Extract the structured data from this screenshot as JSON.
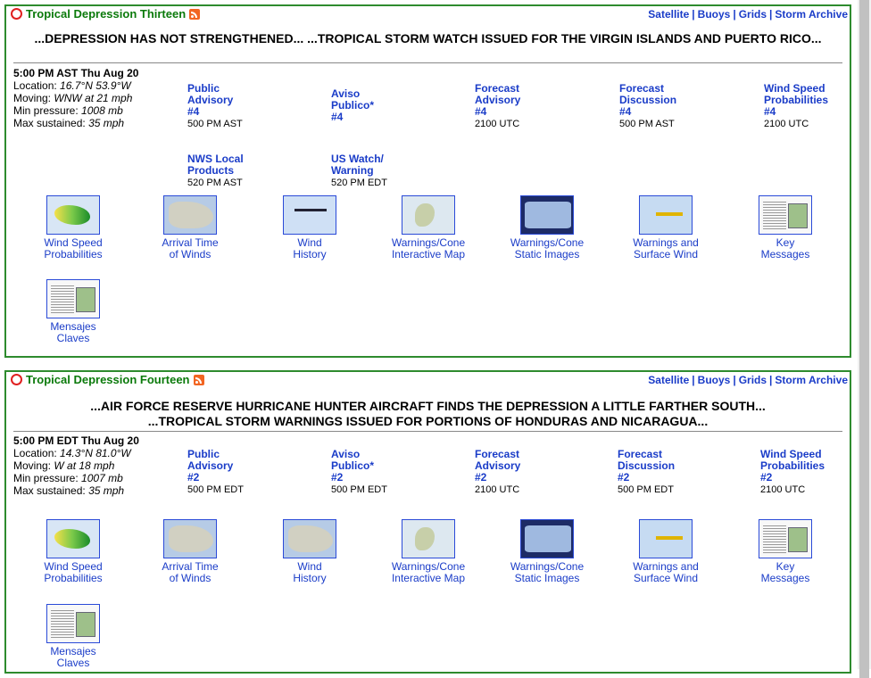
{
  "storms": [
    {
      "title": "Tropical Depression Thirteen",
      "links": [
        "Satellite",
        "Buoys",
        "Grids",
        "Storm Archive"
      ],
      "headline": "...DEPRESSION HAS NOT STRENGTHENED... ...TROPICAL STORM WATCH ISSUED FOR THE VIRGIN ISLANDS AND PUERTO RICO...",
      "datetime": "5:00 PM AST Thu Aug 20",
      "location_label": "Location:",
      "location": "16.7°N 53.9°W",
      "moving_label": "Moving:",
      "moving": "WNW at 21 mph",
      "pressure_label": "Min pressure:",
      "pressure": "1008 mb",
      "sustained_label": "Max sustained:",
      "sustained": "35 mph",
      "products": [
        {
          "line1": "Public",
          "line2": "Advisory",
          "num": "#4",
          "time": "500 PM AST"
        },
        {
          "line1": "Aviso",
          "line2": "Publico*",
          "num": "#4",
          "time": ""
        },
        {
          "line1": "Forecast",
          "line2": "Advisory",
          "num": "#4",
          "time": "2100 UTC"
        },
        {
          "line1": "Forecast",
          "line2": "Discussion",
          "num": "#4",
          "time": "500 PM AST"
        },
        {
          "line1": "Wind Speed",
          "line2": "Probabilities",
          "num": "#4",
          "time": "2100 UTC"
        },
        {
          "line1": "NWS Local",
          "line2": "Products",
          "num": "",
          "time": "520 PM AST"
        },
        {
          "line1": "US Watch/",
          "line2": "Warning",
          "num": "",
          "time": "520 PM EDT"
        }
      ],
      "graphics": [
        {
          "l1": "Wind Speed",
          "l2": "Probabilities",
          "icon": "wind-probability-map-icon"
        },
        {
          "l1": "Arrival Time",
          "l2": "of Winds",
          "icon": "arrival-time-map-icon"
        },
        {
          "l1": "Wind",
          "l2": "History",
          "icon": "wind-history-map-icon"
        },
        {
          "l1": "Warnings/Cone",
          "l2": "Interactive Map",
          "icon": "interactive-map-icon"
        },
        {
          "l1": "Warnings/Cone",
          "l2": "Static Images",
          "icon": "cone-map-icon"
        },
        {
          "l1": "Warnings and",
          "l2": "Surface Wind",
          "icon": "surface-wind-map-icon"
        },
        {
          "l1": "Key",
          "l2": "Messages",
          "icon": "key-messages-doc-icon"
        },
        {
          "l1": "Mensajes",
          "l2": "Claves",
          "icon": "mensajes-claves-doc-icon"
        }
      ]
    },
    {
      "title": "Tropical Depression Fourteen",
      "links": [
        "Satellite",
        "Buoys",
        "Grids",
        "Storm Archive"
      ],
      "headline1": "...AIR FORCE RESERVE HURRICANE HUNTER AIRCRAFT FINDS THE DEPRESSION A LITTLE FARTHER SOUTH...",
      "headline2": "...TROPICAL STORM WARNINGS ISSUED FOR PORTIONS OF HONDURAS AND NICARAGUA...",
      "datetime": "5:00 PM EDT Thu Aug 20",
      "location_label": "Location:",
      "location": "14.3°N 81.0°W",
      "moving_label": "Moving:",
      "moving": "W at 18 mph",
      "pressure_label": "Min pressure:",
      "pressure": "1007 mb",
      "sustained_label": "Max sustained:",
      "sustained": "35 mph",
      "products": [
        {
          "line1": "Public",
          "line2": "Advisory",
          "num": "#2",
          "time": "500 PM EDT"
        },
        {
          "line1": "Aviso",
          "line2": "Publico*",
          "num": "#2",
          "time": "500 PM EDT"
        },
        {
          "line1": "Forecast",
          "line2": "Advisory",
          "num": "#2",
          "time": "2100 UTC"
        },
        {
          "line1": "Forecast",
          "line2": "Discussion",
          "num": "#2",
          "time": "500 PM EDT"
        },
        {
          "line1": "Wind Speed",
          "line2": "Probabilities",
          "num": "#2",
          "time": "2100 UTC"
        }
      ],
      "graphics": [
        {
          "l1": "Wind Speed",
          "l2": "Probabilities",
          "icon": "wind-probability-map-icon"
        },
        {
          "l1": "Arrival Time",
          "l2": "of Winds",
          "icon": "arrival-time-map-icon"
        },
        {
          "l1": "Wind",
          "l2": "History",
          "icon": "wind-history-map-icon"
        },
        {
          "l1": "Warnings/Cone",
          "l2": "Interactive Map",
          "icon": "interactive-map-icon"
        },
        {
          "l1": "Warnings/Cone",
          "l2": "Static Images",
          "icon": "cone-map-icon"
        },
        {
          "l1": "Warnings and",
          "l2": "Surface Wind",
          "icon": "surface-wind-map-icon"
        },
        {
          "l1": "Key",
          "l2": "Messages",
          "icon": "key-messages-doc-icon"
        },
        {
          "l1": "Mensajes",
          "l2": "Claves",
          "icon": "mensajes-claves-doc-icon"
        }
      ]
    }
  ],
  "colors": {
    "title_green": "#0b7a0b",
    "link_blue": "#1a3cc8",
    "border_green": "#2e8b2e"
  }
}
